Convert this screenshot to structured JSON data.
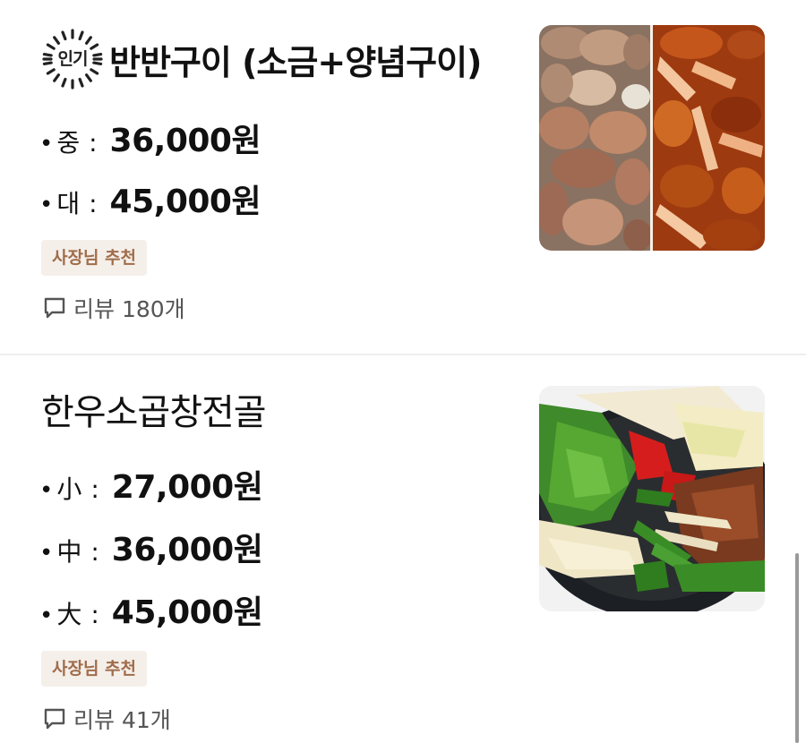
{
  "menu_items": [
    {
      "badge": "인기",
      "title": "반반구이 (소금+양념구이)",
      "prices": [
        {
          "bullet": "•",
          "size": "중",
          "colon": ":",
          "price": "36,000원"
        },
        {
          "bullet": "•",
          "size": "대",
          "colon": ":",
          "price": "45,000원"
        }
      ],
      "tag": "사장님 추천",
      "review_label": "리뷰 180개",
      "image_icon": "grilled-gopchang-photo"
    },
    {
      "title": "한우소곱창전골",
      "prices": [
        {
          "bullet": "•",
          "size": "小",
          "colon": ":",
          "price": "27,000원"
        },
        {
          "bullet": "•",
          "size": "中",
          "colon": ":",
          "price": "36,000원"
        },
        {
          "bullet": "•",
          "size": "大",
          "colon": ":",
          "price": "45,000원"
        }
      ],
      "tag": "사장님 추천",
      "review_label": "리뷰 41개",
      "image_icon": "gopchang-hotpot-photo"
    }
  ],
  "colors": {
    "tag_bg": "#f5efea",
    "tag_text": "#a06d4a",
    "divider": "#eeeeee",
    "review_text": "#555555"
  }
}
